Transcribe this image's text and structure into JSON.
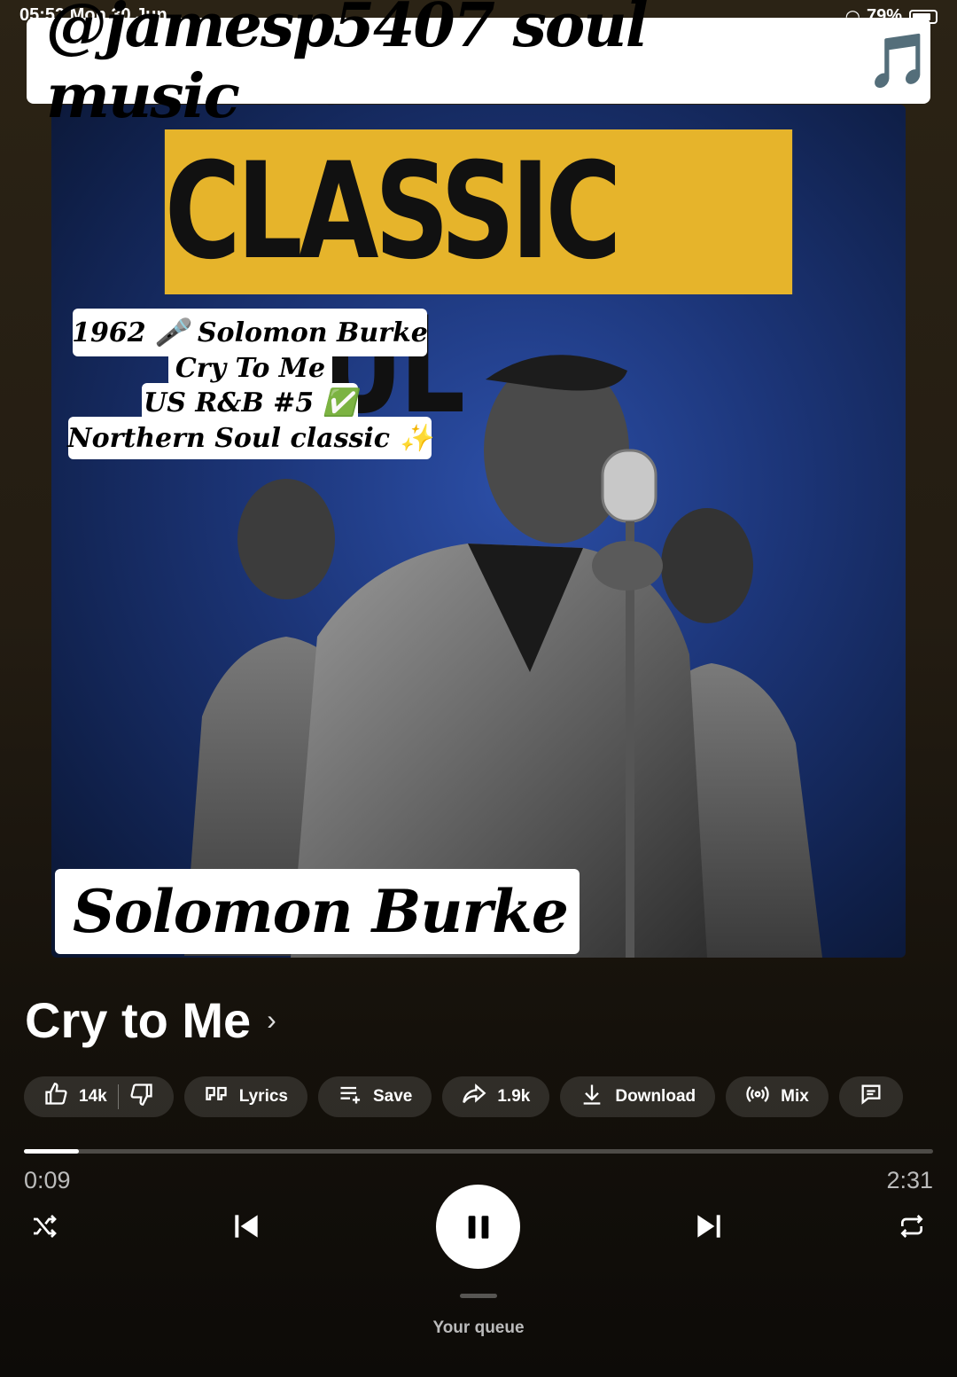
{
  "status_bar": {
    "time": "05:52",
    "date": "Mon 30 Jun",
    "battery": "79%"
  },
  "watermark": {
    "text": "@jamesp5407 soul music",
    "note": "🎵"
  },
  "album_art": {
    "banner": "60s CLASSIC SOUL",
    "info_lines": [
      "1962 🎤 Solomon Burke",
      "Cry To Me",
      "US R&B #5 ✅",
      "Northern Soul classic ✨"
    ],
    "artist_label": "Solomon Burke"
  },
  "song": {
    "title": "Cry to Me"
  },
  "actions": {
    "likes": "14k",
    "lyrics": "Lyrics",
    "save": "Save",
    "shares": "1.9k",
    "download": "Download",
    "mix": "Mix"
  },
  "player": {
    "elapsed": "0:09",
    "duration": "2:31",
    "progress": 0.06
  },
  "queue": {
    "label": "Your queue"
  }
}
